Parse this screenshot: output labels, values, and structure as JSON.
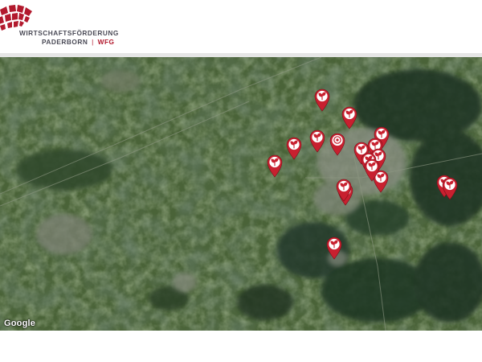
{
  "header": {
    "logo": {
      "line1": "WIRTSCHAFTSFÖRDERUNG",
      "line2_city": "PADERBORN",
      "line2_sep": "|",
      "line2_abbr": "WFG",
      "brand_color": "#b2192d",
      "text_color": "#4a4a56"
    }
  },
  "map": {
    "attribution": "Google",
    "map_type": "satellite",
    "marker_color": "#c8202f",
    "markers": [
      {
        "icon": "sprout-icon"
      },
      {
        "icon": "sprout-icon"
      },
      {
        "icon": "sprout-icon"
      },
      {
        "icon": "sprout-icon"
      },
      {
        "icon": "sprout-icon"
      },
      {
        "icon": "target-icon"
      },
      {
        "icon": "sprout-icon"
      },
      {
        "icon": "sprout-icon"
      },
      {
        "icon": "sprout-icon"
      },
      {
        "icon": "sprout-icon"
      },
      {
        "icon": "sprout-icon"
      },
      {
        "icon": "sprout-icon"
      },
      {
        "icon": "sprout-icon"
      },
      {
        "icon": "sprout-icon"
      },
      {
        "icon": "sprout-icon"
      },
      {
        "icon": "sprout-icon"
      },
      {
        "icon": "sprout-icon"
      },
      {
        "icon": "sprout-icon"
      }
    ]
  }
}
